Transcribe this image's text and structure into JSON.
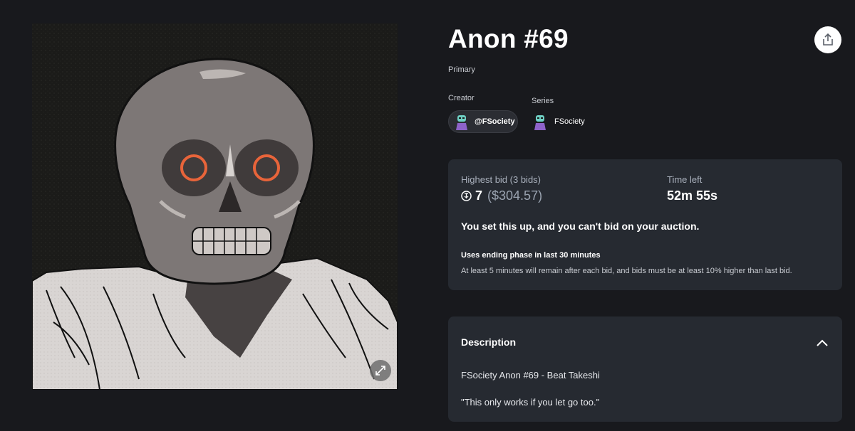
{
  "nft": {
    "title": "Anon #69",
    "sale_type": "Primary"
  },
  "creator": {
    "label": "Creator",
    "handle": "@FSociety"
  },
  "series": {
    "label": "Series",
    "name": "FSociety"
  },
  "auction": {
    "highest_bid_label": "Highest bid (3 bids)",
    "bid_amount": "7",
    "bid_usd": "($304.57)",
    "time_left_label": "Time left",
    "time_left": "52m 55s",
    "notice": "You set this up, and you can't bid on your auction.",
    "ending_phase_title": "Uses ending phase in last 30 minutes",
    "ending_phase_desc": "At least 5 minutes will remain after each bid, and bids must be at least 10% higher than last bid."
  },
  "description": {
    "label": "Description",
    "line1": "FSociety Anon #69 - Beat Takeshi",
    "line2": "\"This only works if you let go too.\""
  },
  "icons": {
    "share": "share-icon",
    "expand": "expand-icon",
    "collapse": "chevron-up-icon",
    "currency": "tezos-icon"
  },
  "colors": {
    "background": "#18191d",
    "card": "#262a31",
    "eye_ring": "#e8643a"
  }
}
